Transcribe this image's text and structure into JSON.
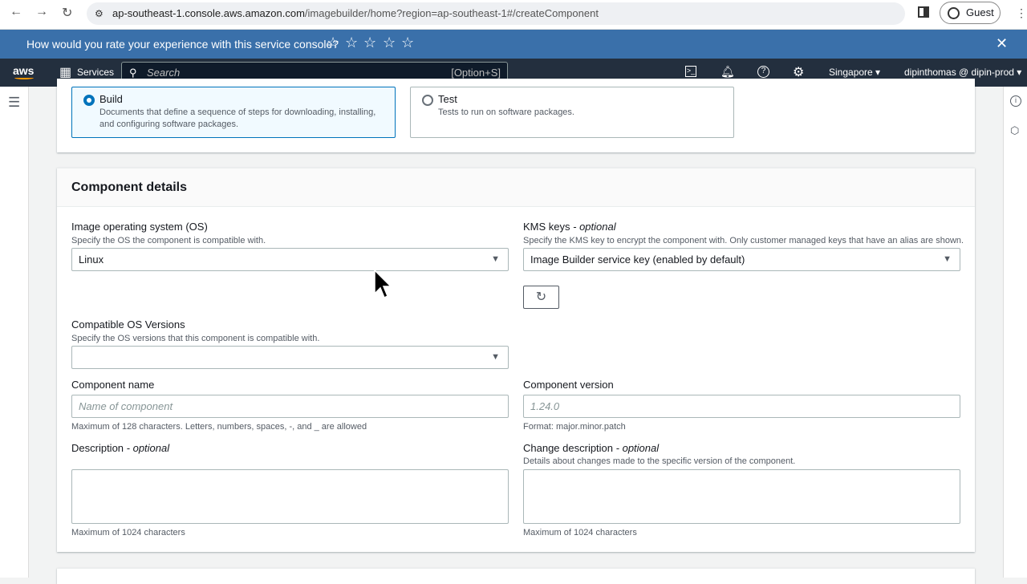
{
  "browser": {
    "url_host": "ap-southeast-1.console.aws.amazon.com",
    "url_path": "/imagebuilder/home?region=ap-southeast-1#/createComponent",
    "profile": "Guest"
  },
  "banner": {
    "question": "How would you rate your experience with this service console?",
    "stars": 5
  },
  "awsnav": {
    "logo": "aws",
    "services": "Services",
    "search_placeholder": "Search",
    "search_shortcut": "[Option+S]",
    "region": "Singapore",
    "account": "dipinthomas @ dipin-prod"
  },
  "type": {
    "build": {
      "label": "Build",
      "desc": "Documents that define a sequence of steps for downloading, installing, and configuring software packages."
    },
    "test": {
      "label": "Test",
      "desc": "Tests to run on software packages."
    }
  },
  "details": {
    "title": "Component details",
    "os": {
      "label": "Image operating system (OS)",
      "hint": "Specify the OS the component is compatible with.",
      "value": "Linux"
    },
    "kms": {
      "label": "KMS keys",
      "optional": "- optional",
      "hint": "Specify the KMS key to encrypt the component with. Only customer managed keys that have an alias are shown.",
      "value": "Image Builder service key (enabled by default)"
    },
    "os_versions": {
      "label": "Compatible OS Versions",
      "hint": "Specify the OS versions that this component is compatible with.",
      "value": ""
    },
    "name": {
      "label": "Component name",
      "placeholder": "Name of component",
      "hint": "Maximum of 128 characters. Letters, numbers, spaces, -, and _ are allowed"
    },
    "version": {
      "label": "Component version",
      "placeholder": "1.24.0",
      "hint": "Format: major.minor.patch"
    },
    "description": {
      "label": "Description",
      "optional": "- optional",
      "hint": "Maximum of 1024 characters"
    },
    "change": {
      "label": "Change description",
      "optional": "- optional",
      "sub": "Details about changes made to the specific version of the component.",
      "hint": "Maximum of 1024 characters"
    }
  }
}
